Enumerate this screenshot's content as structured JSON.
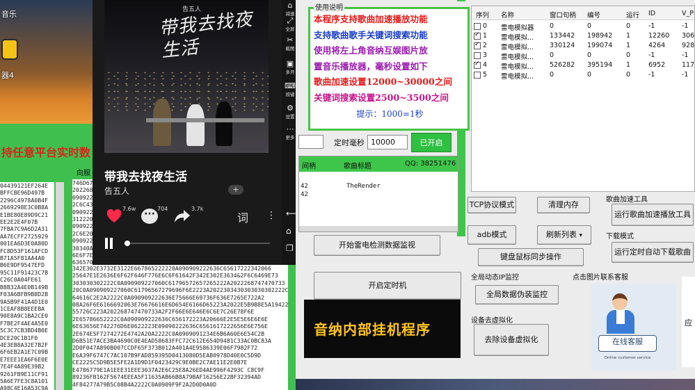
{
  "desktop": {
    "top_label": "音乐",
    "icon_label": "器4"
  },
  "left_app": {
    "banner": "持任意平台实时数",
    "pane_title": "向服",
    "hex_col1": "04439121EF264E\nBFFCBE96D497B\n2296C4978A0B4F\n2669298E3C0B8A\nE1BE80E89D9C21\nEE2E2E4F07B\n7FBA7C9A6D2A31\nAA7ECFF2725929\n001EA6D3E0A80D\nFC8D53F161AFCD\nB71A5F81AA4A0\nB6E9DF9547EFD\n95C11F91423C7B\nC26C0A04FE61\nB8B32A4E0B149B\nF03A6BFB9B8D2B\n9A5B9F41A4D1E0\n1CEAF8B8EEEBA\n90E8A9C1BA2CE0\nF7BE2F4AE4A5E0\n5C3C7CB3BD4B0E\nDCE20C1B1F0\n4E3EB8A32E7B2F\n6F6EB2A1E7C09B\nE7EEE1EA6F6E0E\n7E4F4A89E39B2\n9261FB9E11CF91\n5A6E7FE3C8A101\nA98C4E16A53C9A\n2E7FAEBC58DB9C\nE53F8B47A2C0E1\n0C94DEF09F1B80\nFF4A4F3C7D89A9\n4EBC5B5C0B71A3\nEE7B1F9A16C40E\n8A2C9DF3A8E8F4",
    "hex_col2": "746D67\n202268\n090922\n2C6C43\n090922\n312220\n090922\n2C6E20\n090922\n30340A\n6E6F7E\n636570\n090922\n706C61\n2066B3\n6E6F7E\n7A2066\n686F7E\n2C6C43\n090922\n34233F\n222E6E\n6E6F7E\n312220\n2C6C43\n6E6F7E\n090922\n2C6C43\n636570\n202268\n706C61",
    "hex_main": "342E302E3732E3122E667865222220A090909222636C65617222342066\n25647E1E2636E6F62F646F776E6C6F61642F342E302E3634&2F6C6469E73\n303030302222C0A090909227060C61796572657265222A2022268747470733\n20C0A090909227060C61796567279696F6E2223A2022303430303030302222C\n64616C2E2A2222C0A090909222636E75666E69736F636E7265E722A2\n08A26F6E6166692063E76676616E6D654E6166D65223A2022E5B9B8E5A194222\n55726C223A202268747470733A2F2F66E6E646E6C6E7C26E78F6E\n2E65786652222C0A090909222636C656172223A20666E2E5E5E6E6E6E\n6E63656E742276D6E0622223E09090222636C6561617222656E6E756E\n2E674E5F7274272E4742A20A2222C0A0909091234E6B6A60E6E54C2B\nD6B51E7ACE3BA4690C0E4EAD58683FFC72C612E654D9481C33AC0BC83A\n2D0F047A890B007CCDF65F373B012A401A4E9586339E06F7982F72\nE6A39F6747C7AC107B9FAD859395D0413080D5EAB0978D40E0C5D9D\nCE2225C5D9B5E5FE2A1D9D1F0423429C9E0BE2C7AE11E2E0B7E\nE4786779E1A1EEE31EEE3037A2E6C25E8A26ED4AE996F4293C C8C9F\n89236FB162F5674EEEA5F11635AB66B8A79BAF16256E22BF32394AD\n4F84277A79B5C08B4A2222C0A0909F9F2A2D0D0A0D"
  },
  "phone": {
    "brand": "告五人",
    "calligraphy": "带我去找夜生活",
    "song_title": "带我去找夜生活",
    "artist": "告五人",
    "plus_label": "+",
    "likes": "7.6w",
    "comments": "704",
    "shares": "3.7k",
    "ci_label": "词",
    "progress": 0.02,
    "side": [
      {
        "glyph": "⌂",
        "label": "减速"
      },
      {
        "glyph": "⤢",
        "label": "全屏"
      },
      {
        "glyph": "✂",
        "label": "截图"
      },
      {
        "glyph": "▣",
        "label": "多开"
      },
      {
        "glyph": "⌨",
        "label": "按键"
      },
      {
        "glyph": "⚙",
        "label": "设置"
      },
      {
        "glyph": "⋯",
        "label": "更多"
      }
    ]
  },
  "app": {
    "instructions_title": "使用说明",
    "lines": [
      "本程序支持歌曲加速播放功能",
      "支持歌曲歌手关键词搜索功能",
      "使用将左上角音纳互娱图片放",
      "置音乐播放器，毫秒设置如下",
      "歌曲加速设置12000~30000之间",
      "关键词搜索设置2500~3500之间"
    ],
    "hint": "提示：1000=1秒",
    "timer_label": "定时毫秒",
    "timer_value": "10000",
    "started_button": "已开启",
    "list_headers": {
      "col1": "间柄",
      "col2": "歌曲标题",
      "col3": "QQ: 38251476"
    },
    "list_rows": [
      {
        "handle": "42",
        "title": "TheRender"
      },
      {
        "handle": "42",
        "title": ""
      }
    ],
    "start_monitor_button": "开始雷电检测数据监视",
    "start_timer_button": "开启定时机",
    "banner": "音纳内部挂机程序",
    "tcp_button": "TCP协议模式",
    "clear_mem_button": "清理内存",
    "adb_button": "adb模式",
    "refresh_button": "刷新列表",
    "refresh_arrow": "▾",
    "sync_button": "键盘鼠标同步操作",
    "song_speed_group": "歌曲加速工具",
    "run_speed_button": "运行歌曲加速播放工具",
    "download_group": "下载模式",
    "run_download_button": "运行定时自动下载歌曲",
    "ip_group": "全局动态IP监控",
    "global_fake_button": "全局数据伪装监控",
    "devices_group": "设备去虚拟化",
    "devirt_button": "去除设备虚拟化",
    "service_group": "点击图片联系客服",
    "service_button": "在线客服",
    "service_sub": "Online customer service",
    "right_card_text": "应",
    "table_headers": {
      "idx": "序列",
      "name": "名称",
      "hwnd": "窗口句柄",
      "num": "编号",
      "running": "运行",
      "id": "ID",
      "vp": "V_PI"
    },
    "table_rows": [
      {
        "check": false,
        "idx": "0",
        "name": "雷电模拟器",
        "hwnd": "0",
        "num": "0",
        "running": "0",
        "id": "-1",
        "vp": "-1"
      },
      {
        "check": true,
        "idx": "1",
        "name": "雷电模拟...",
        "hwnd": "133442",
        "num": "198942",
        "running": "1",
        "id": "12260",
        "vp": "3064"
      },
      {
        "check": true,
        "idx": "2",
        "name": "雷电模拟...",
        "hwnd": "330124",
        "num": "199074",
        "running": "1",
        "id": "4264",
        "vp": "9284"
      },
      {
        "check": false,
        "idx": "3",
        "name": "雷电模拟...",
        "hwnd": "0",
        "num": "0",
        "running": "0",
        "id": "-1",
        "vp": "-1"
      },
      {
        "check": true,
        "idx": "4",
        "name": "雷电模拟...",
        "hwnd": "526282",
        "num": "395194",
        "running": "1",
        "id": "6952",
        "vp": "1174"
      },
      {
        "check": false,
        "idx": "5",
        "name": "雷电模拟...",
        "hwnd": "0",
        "num": "0",
        "running": "0",
        "id": "-1",
        "vp": "-1"
      }
    ]
  },
  "colors": {
    "accent_green": "#3ec64a",
    "banner_text": "#ffc51f",
    "heart": "#ff2a4a"
  }
}
